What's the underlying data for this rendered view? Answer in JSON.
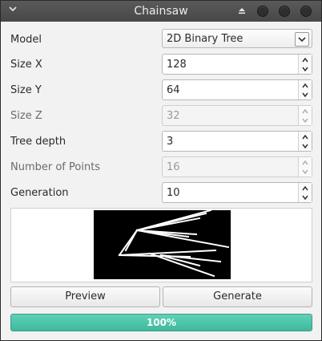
{
  "window": {
    "title": "Chainsaw"
  },
  "form": {
    "model": {
      "label": "Model",
      "value": "2D Binary Tree"
    },
    "size_x": {
      "label": "Size X",
      "value": "128"
    },
    "size_y": {
      "label": "Size Y",
      "value": "64"
    },
    "size_z": {
      "label": "Size Z",
      "value": "32"
    },
    "tree_depth": {
      "label": "Tree depth",
      "value": "3"
    },
    "num_points": {
      "label": "Number of Points",
      "value": "16"
    },
    "generation": {
      "label": "Generation",
      "value": "10"
    }
  },
  "buttons": {
    "preview": "Preview",
    "generate": "Generate"
  },
  "progress": {
    "value": 100,
    "label": "100%"
  },
  "colors": {
    "progress": "#45bfa3",
    "titlebar": "#4e4e4e"
  },
  "icons": {
    "window_menu": "chevron-down-icon",
    "shade": "shade-icon",
    "spin_up": "arrow-up-icon",
    "spin_down": "arrow-down-icon"
  }
}
